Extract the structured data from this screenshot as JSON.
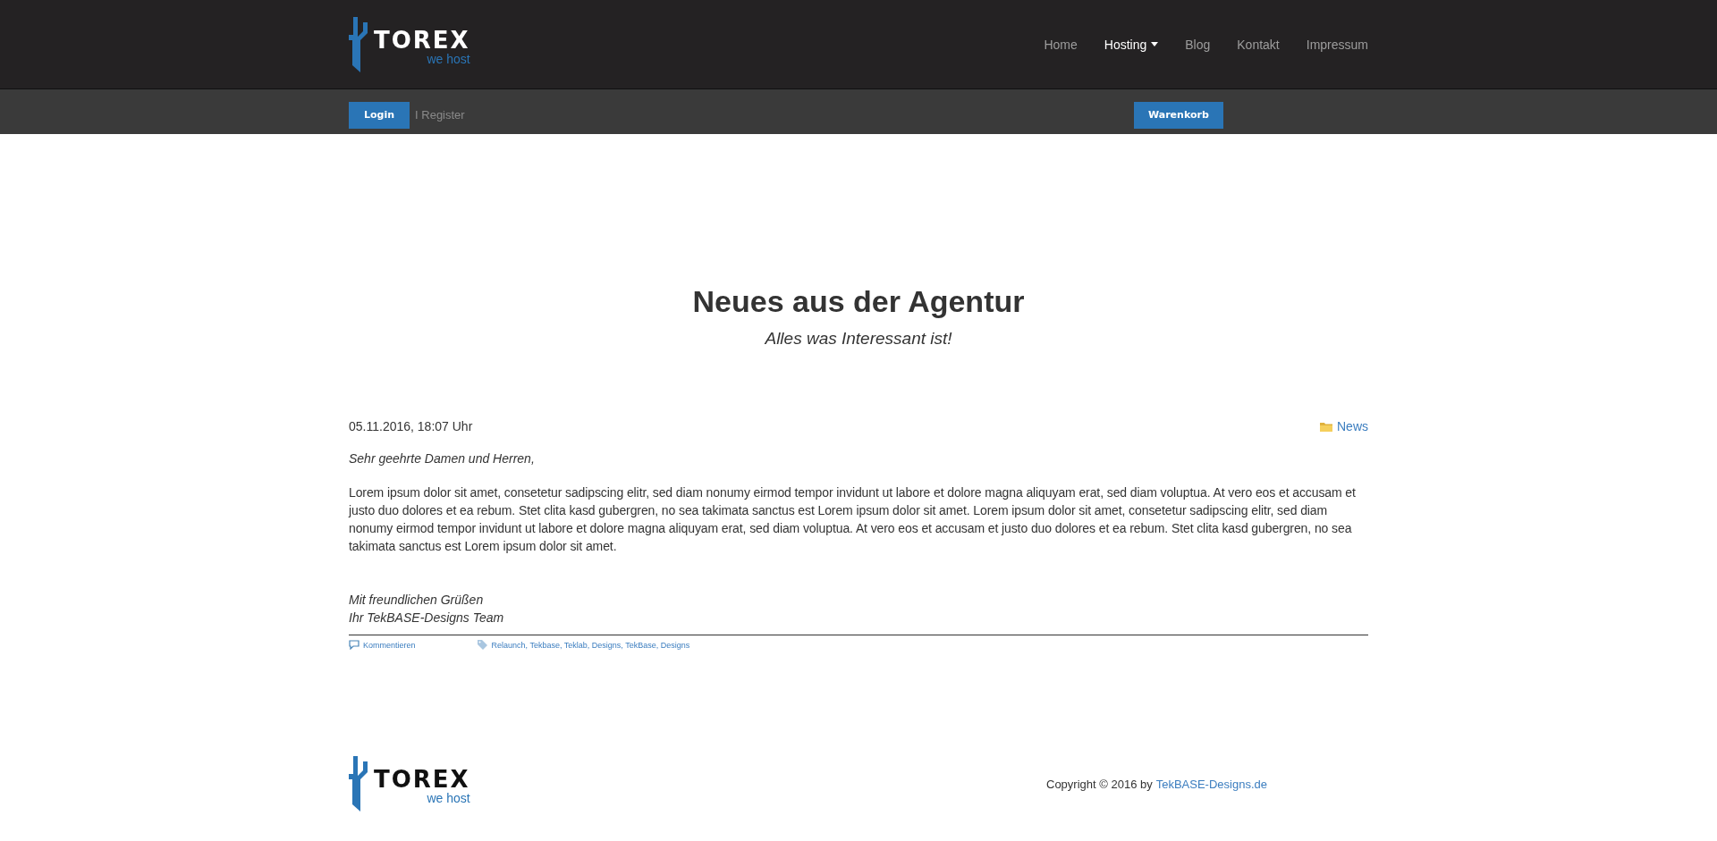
{
  "header": {
    "logo": {
      "name": "TOREX",
      "tagline": "we host"
    },
    "nav": [
      {
        "label": "Home",
        "selected": false,
        "dropdown": false
      },
      {
        "label": "Hosting",
        "selected": true,
        "dropdown": true
      },
      {
        "label": "Blog",
        "selected": false,
        "dropdown": false
      },
      {
        "label": "Kontakt",
        "selected": false,
        "dropdown": false
      },
      {
        "label": "Impressum",
        "selected": false,
        "dropdown": false
      }
    ]
  },
  "account_bar": {
    "login": "Login",
    "register": "I Register",
    "cart": "Warenkorb"
  },
  "page": {
    "title": "Neues aus der Agentur",
    "subtitle": "Alles was Interessant ist!"
  },
  "post": {
    "date": "05.11.2016, 18:07 Uhr",
    "category": "News",
    "greeting": "Sehr geehrte Damen und Herren,",
    "body": "Lorem ipsum dolor sit amet, consetetur sadipscing elitr, sed diam nonumy eirmod tempor invidunt ut labore et dolore magna aliquyam erat, sed diam voluptua. At vero eos et accusam et justo duo dolores et ea rebum. Stet clita kasd gubergren, no sea takimata sanctus est Lorem ipsum dolor sit amet. Lorem ipsum dolor sit amet, consetetur sadipscing elitr, sed diam nonumy eirmod tempor invidunt ut labore et dolore magna aliquyam erat, sed diam voluptua. At vero eos et accusam et justo duo dolores et ea rebum. Stet clita kasd gubergren, no sea takimata sanctus est Lorem ipsum dolor sit amet.",
    "closing": [
      "Mit freundlichen Grüßen",
      "Ihr TekBASE-Designs Team"
    ],
    "comment_link": "Kommentieren",
    "tags": "Relaunch, Tekbase, Teklab, Designs, TekBase, Designs"
  },
  "footer": {
    "logo": {
      "name": "TOREX",
      "tagline": "we host"
    },
    "copyright": "Copyright © 2016 by",
    "copyright_link": "TekBASE-Designs.de"
  }
}
